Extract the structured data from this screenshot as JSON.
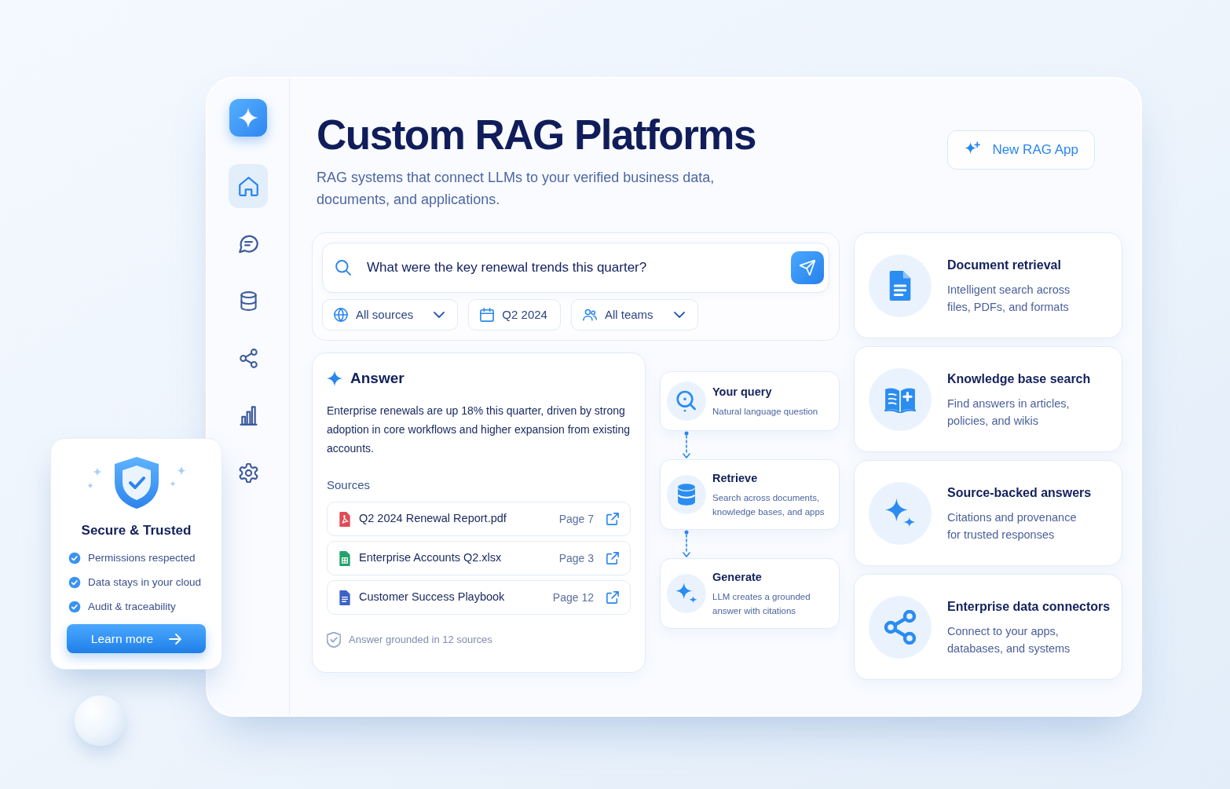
{
  "sidebar": {
    "items": [
      {
        "kind": "home",
        "selected": true
      },
      {
        "kind": "chat",
        "selected": false
      },
      {
        "kind": "database",
        "selected": false
      },
      {
        "kind": "share",
        "selected": false
      },
      {
        "kind": "chart",
        "selected": false
      },
      {
        "kind": "settings",
        "selected": false
      }
    ]
  },
  "header": {
    "title": "Custom RAG Platforms",
    "subtitle": "RAG systems that connect LLMs to your verified business data, documents, and applications.",
    "new_app_button": "New RAG App"
  },
  "search": {
    "value": "What were the key renewal trends this quarter?",
    "filters": [
      {
        "kind": "globe",
        "label": "All sources",
        "dropdown": true
      },
      {
        "kind": "calendar",
        "label": "Q2 2024",
        "dropdown": false
      },
      {
        "kind": "people",
        "label": "All teams",
        "dropdown": true
      }
    ]
  },
  "answer": {
    "title": "Answer",
    "text": "Enterprise renewals are up 18% this quarter, driven by strong adoption in core workflows and higher expansion from existing accounts.",
    "sources_label": "Sources",
    "sources": [
      {
        "kind": "pdf",
        "name": "Q2 2024 Renewal Report.pdf",
        "page": "Page 7"
      },
      {
        "kind": "xlsx",
        "name": "Enterprise Accounts Q2.xlsx",
        "page": "Page 3"
      },
      {
        "kind": "doc",
        "name": "Customer Success Playbook",
        "page": "Page 12"
      }
    ],
    "footer": "Answer grounded in 12 sources"
  },
  "pipeline": [
    {
      "kind": "query",
      "title": "Your query",
      "description": "Natural language question"
    },
    {
      "kind": "retrieve",
      "title": "Retrieve",
      "description": "Search across documents, knowledge bases, and apps"
    },
    {
      "kind": "generate",
      "title": "Generate",
      "description": "LLM creates a grounded answer with citations"
    }
  ],
  "features": [
    {
      "kind": "document",
      "title": "Document retrieval",
      "description": "Intelligent search across files, PDFs, and formats"
    },
    {
      "kind": "book",
      "title": "Knowledge base search",
      "description": "Find answers in articles, policies, and wikis"
    },
    {
      "kind": "sparkles",
      "title": "Source-backed answers",
      "description": "Citations and provenance for trusted responses"
    },
    {
      "kind": "connectors",
      "title": "Enterprise data connectors",
      "description": "Connect to your apps, databases, and systems"
    }
  ],
  "trust_card": {
    "title": "Secure & Trusted",
    "items": [
      {
        "label": "Permissions respected",
        "checked": true
      },
      {
        "label": "Data stays in your cloud",
        "checked": true
      },
      {
        "label": "Audit & traceability",
        "checked": true
      }
    ],
    "button": "Learn more"
  }
}
